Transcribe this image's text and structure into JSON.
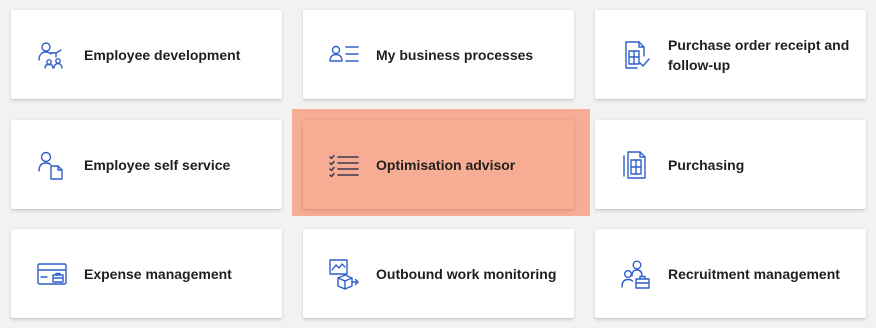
{
  "tiles": [
    {
      "label": "Employee development",
      "icon": "employee-development-icon"
    },
    {
      "label": "My business processes",
      "icon": "business-processes-icon"
    },
    {
      "label": "Purchase order receipt and follow-up",
      "icon": "purchase-order-receipt-icon"
    },
    {
      "label": "Employee self service",
      "icon": "employee-self-service-icon"
    },
    {
      "label": "Optimisation advisor",
      "icon": "checklist-icon",
      "highlighted": true
    },
    {
      "label": "Purchasing",
      "icon": "purchasing-document-icon"
    },
    {
      "label": "Expense management",
      "icon": "expense-card-icon"
    },
    {
      "label": "Outbound work monitoring",
      "icon": "outbound-work-icon"
    },
    {
      "label": "Recruitment management",
      "icon": "recruitment-icon"
    }
  ],
  "colors": {
    "page_background": "#f3f2f1",
    "tile_background": "#ffffff",
    "icon_accent": "#2f5fc9",
    "highlight": "#f6ad94",
    "label_text": "#201f1e"
  }
}
